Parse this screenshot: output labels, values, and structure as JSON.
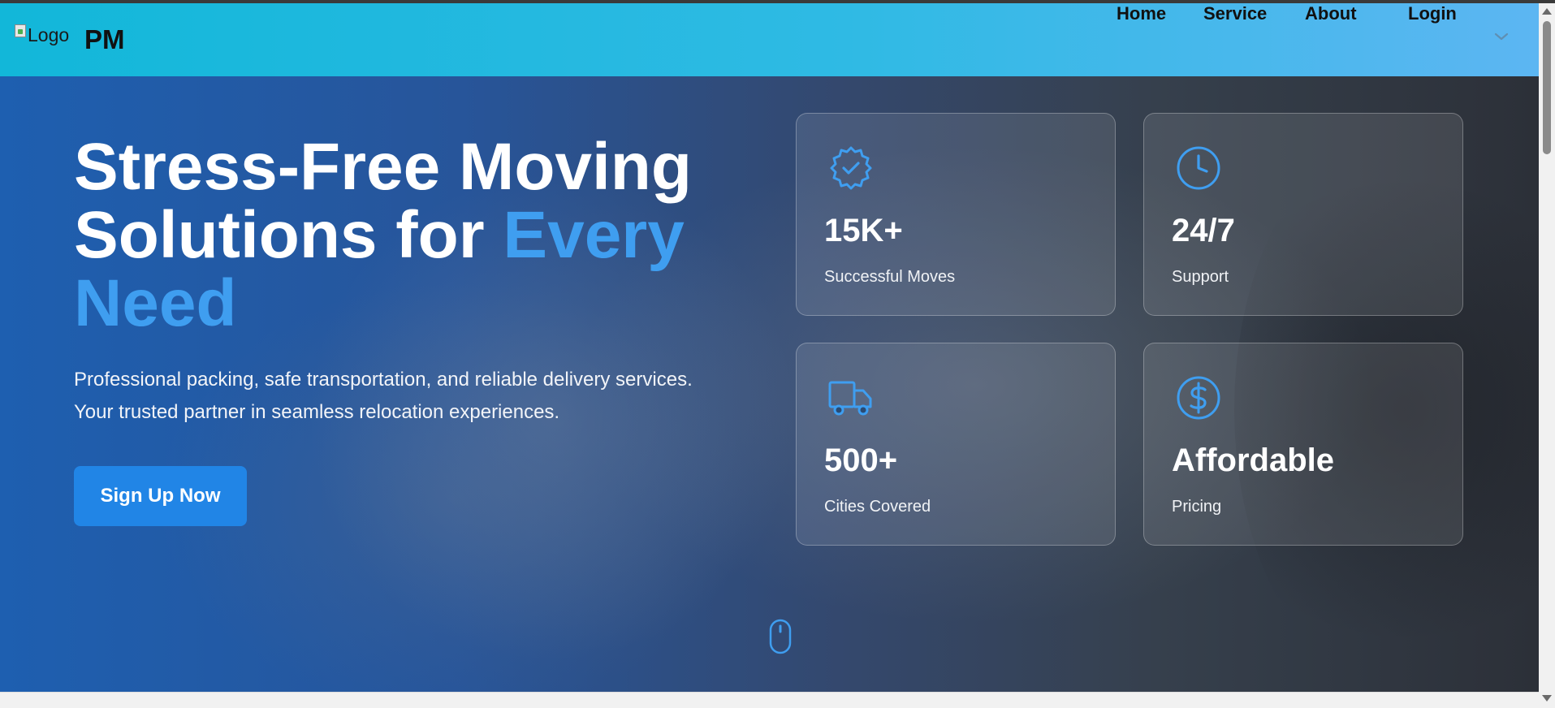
{
  "header": {
    "logo_alt": "Logo",
    "brand": "PM",
    "nav": [
      {
        "label": "Home"
      },
      {
        "label": "Service"
      },
      {
        "label": "About"
      },
      {
        "label": "Login"
      }
    ],
    "dropdown_icon": "chevron-down-icon"
  },
  "hero": {
    "headline_white": "Stress-Free Moving Solutions for ",
    "headline_accent": "Every Need",
    "subtext_line1": "Professional packing, safe transportation, and reliable delivery services.",
    "subtext_line2": "Your trusted partner in seamless relocation experiences.",
    "cta_label": "Sign Up Now",
    "scroll_icon": "mouse-scroll-icon"
  },
  "stats": [
    {
      "icon": "verified-badge-icon",
      "value": "15K+",
      "label": "Successful Moves"
    },
    {
      "icon": "clock-icon",
      "value": "24/7",
      "label": "Support"
    },
    {
      "icon": "truck-icon",
      "value": "500+",
      "label": "Cities Covered"
    },
    {
      "icon": "dollar-icon",
      "value": "Affordable",
      "label": "Pricing"
    }
  ],
  "colors": {
    "accent": "#3f9ef0",
    "button": "#2185e6",
    "nav_gradient_start": "#12b7d9",
    "nav_gradient_end": "#5cb6f2"
  }
}
